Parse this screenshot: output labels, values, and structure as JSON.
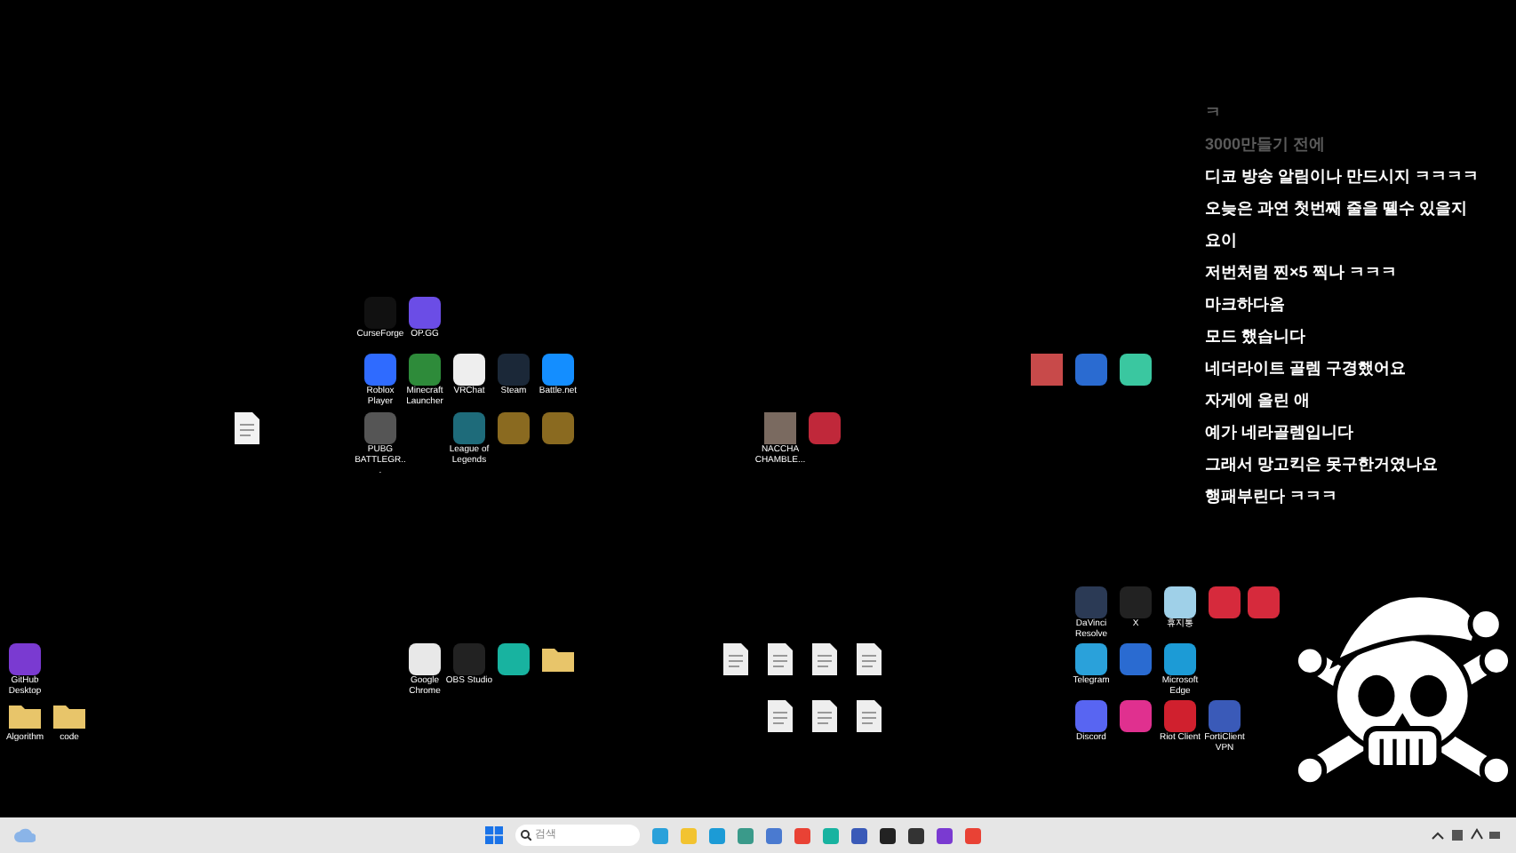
{
  "desktop_icons": [
    {
      "kind": "app",
      "label": "CurseForge"
    },
    {
      "kind": "app",
      "label": "OP.GG"
    },
    {
      "kind": "app",
      "label": "Roblox Player"
    },
    {
      "kind": "app",
      "label": "Minecraft Launcher"
    },
    {
      "kind": "app",
      "label": "VRChat"
    },
    {
      "kind": "app",
      "label": "Steam"
    },
    {
      "kind": "app",
      "label": "Battle.net"
    },
    {
      "kind": "file"
    },
    {
      "kind": "app",
      "label": "PUBG BATTLEGR..."
    },
    {
      "kind": "app",
      "label": "League of Legends"
    },
    {
      "kind": "app"
    },
    {
      "kind": "app"
    },
    {
      "kind": "photo",
      "label": "NACCHA CHAMBLE..."
    },
    {
      "kind": "app"
    },
    {
      "kind": "photo"
    },
    {
      "kind": "app"
    },
    {
      "kind": "app"
    },
    {
      "kind": "app",
      "label": "GitHub Desktop"
    },
    {
      "kind": "folder",
      "label": "Algorithm"
    },
    {
      "kind": "folder",
      "label": "code"
    },
    {
      "kind": "app",
      "label": "Google Chrome"
    },
    {
      "kind": "app",
      "label": "OBS Studio"
    },
    {
      "kind": "app"
    },
    {
      "kind": "folder"
    },
    {
      "kind": "file"
    },
    {
      "kind": "file"
    },
    {
      "kind": "file"
    },
    {
      "kind": "file"
    },
    {
      "kind": "file"
    },
    {
      "kind": "file"
    },
    {
      "kind": "file"
    },
    {
      "kind": "app",
      "label": "DaVinci Resolve"
    },
    {
      "kind": "app",
      "label": "X"
    },
    {
      "kind": "app",
      "label": "휴지통"
    },
    {
      "kind": "app"
    },
    {
      "kind": "app"
    },
    {
      "kind": "app",
      "label": "Telegram"
    },
    {
      "kind": "app"
    },
    {
      "kind": "app",
      "label": "Microsoft Edge"
    },
    {
      "kind": "app",
      "label": "Discord"
    },
    {
      "kind": "app"
    },
    {
      "kind": "app",
      "label": "Riot Client"
    },
    {
      "kind": "app",
      "label": "FortiClient VPN"
    }
  ],
  "chat_overlay": {
    "messages": [
      {
        "text": "ㅋ",
        "kind": "faded"
      },
      {
        "text": "3000만들기 전에",
        "kind": "faded"
      },
      {
        "text": "디코 방송 알림이나 만드시지 ㅋㅋㅋㅋ",
        "kind": "normal"
      },
      {
        "text": "오늦은 과연 첫번째 줄을 뗄수 있을지",
        "kind": "normal"
      },
      {
        "text": "요이",
        "kind": "normal"
      },
      {
        "text": "저번처럼 찐×5 찍나 ㅋㅋㅋ",
        "kind": "normal"
      },
      {
        "text": "마크하다옴",
        "kind": "normal"
      },
      {
        "text": "모드 했습니다",
        "kind": "normal"
      },
      {
        "text": "네더라이트 골렘 구경했어요",
        "kind": "normal"
      },
      {
        "text": "자게에 올린 애",
        "kind": "normal"
      },
      {
        "text": "예가 네라골렘입니다",
        "kind": "normal"
      },
      {
        "text": "그래서 망고킥은 못구한거였나요",
        "kind": "normal"
      },
      {
        "text": "행패부린다 ㅋㅋㅋ",
        "kind": "normal"
      }
    ]
  },
  "taskbar": {
    "search": {
      "placeholder": "검색"
    }
  }
}
